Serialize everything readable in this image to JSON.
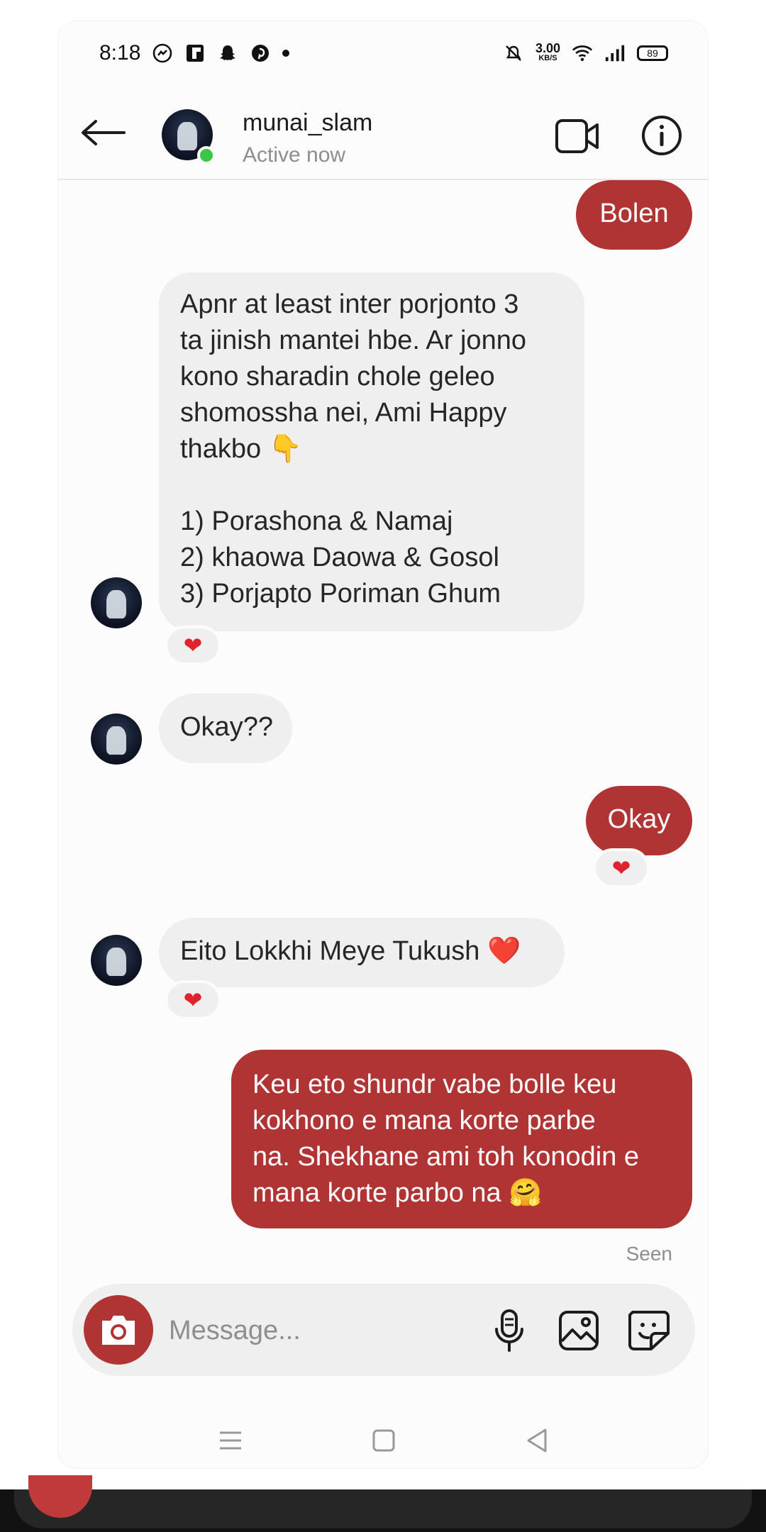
{
  "status_bar": {
    "time": "8:18",
    "icons_left": [
      "messenger-icon",
      "flipboard-icon",
      "snapchat-icon",
      "pinterest-icon"
    ],
    "net_speed_value": "3.00",
    "net_speed_unit": "KB/S",
    "battery": "89",
    "icons_right": [
      "mute-icon",
      "wifi-icon",
      "signal-icon"
    ]
  },
  "header": {
    "username": "munai_slam",
    "status": "Active now"
  },
  "messages": [
    {
      "dir": "out",
      "text": "Bolen"
    },
    {
      "dir": "in",
      "lines": [
        "Apnr at least inter porjonto 3",
        "ta jinish mantei hbe. Ar jonno",
        "kono sharadin chole geleo",
        "shomossha nei, Ami Happy",
        "thakbo 👇",
        "",
        "1) Porashona & Namaj",
        "2) khaowa Daowa & Gosol",
        "3) Porjapto Poriman Ghum"
      ],
      "reaction": "❤"
    },
    {
      "dir": "in",
      "text": "Okay??"
    },
    {
      "dir": "out",
      "text": "Okay",
      "reaction": "❤"
    },
    {
      "dir": "in",
      "text": "Eito Lokkhi Meye Tukush ❤️",
      "reaction": "❤"
    },
    {
      "dir": "out",
      "lines": [
        "Keu eto shundr vabe bolle keu",
        "kokhono e mana korte parbe",
        "na. Shekhane ami toh konodin e",
        "mana korte parbo na 🤗"
      ]
    }
  ],
  "seen_label": "Seen",
  "composer": {
    "placeholder": "Message..."
  },
  "colors": {
    "accent": "#b13434",
    "incoming_bubble": "#efefef",
    "online": "#3dc545",
    "heart": "#e0242f"
  }
}
